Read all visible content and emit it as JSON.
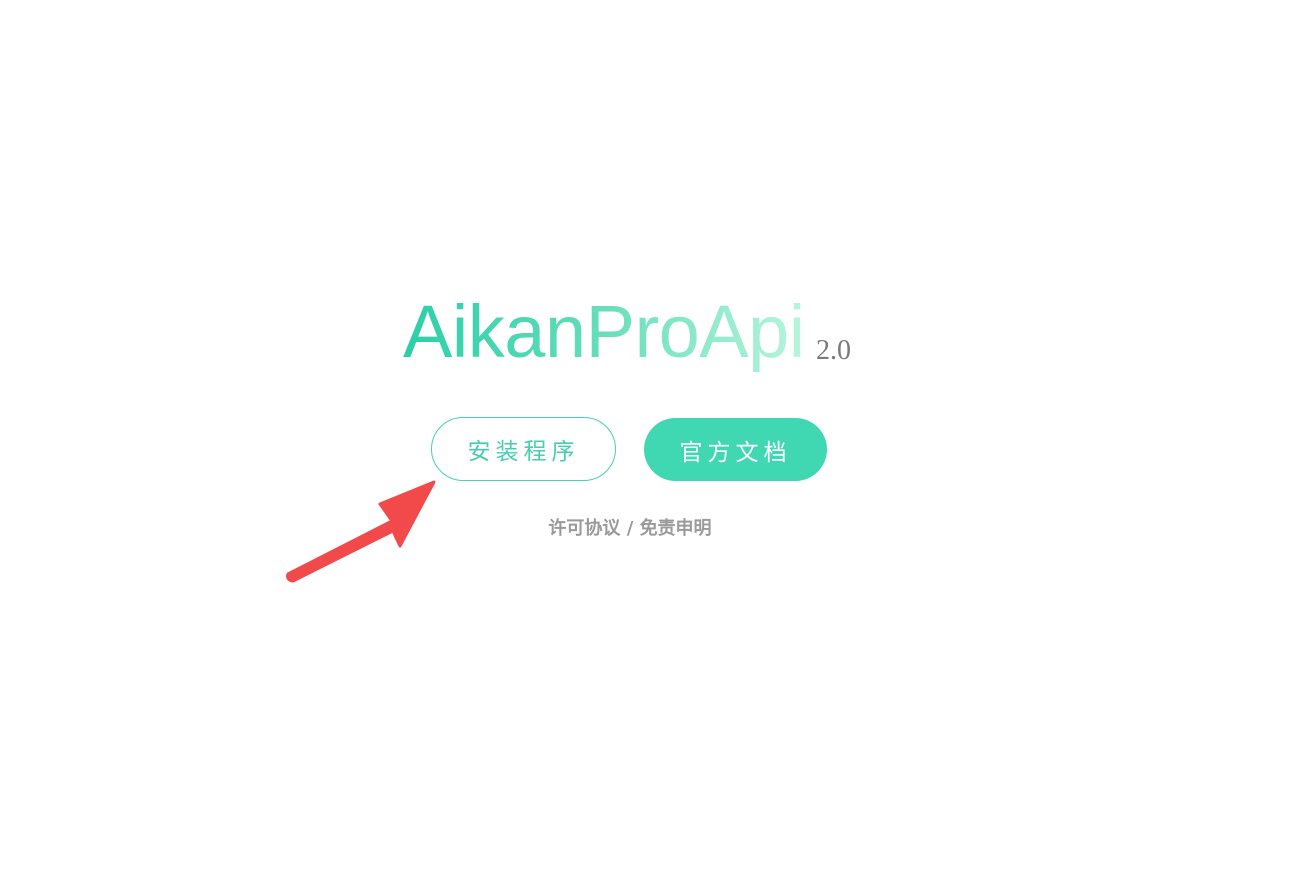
{
  "header": {
    "title": "AikanProApi",
    "version": "2.0"
  },
  "actions": {
    "install_label": "安装程序",
    "docs_label": "官方文档"
  },
  "footer": {
    "license_label": "许可协议",
    "separator": "/",
    "disclaimer_label": "免责申明"
  },
  "annotation": {
    "arrow_color": "#f24a4a",
    "icon": "red-arrow-icon"
  },
  "colors": {
    "accent": "#3fd8b3",
    "title_gradient_start": "#2ccfa8",
    "title_gradient_end": "#b8f5dc",
    "muted_text": "#9a9a9a"
  }
}
